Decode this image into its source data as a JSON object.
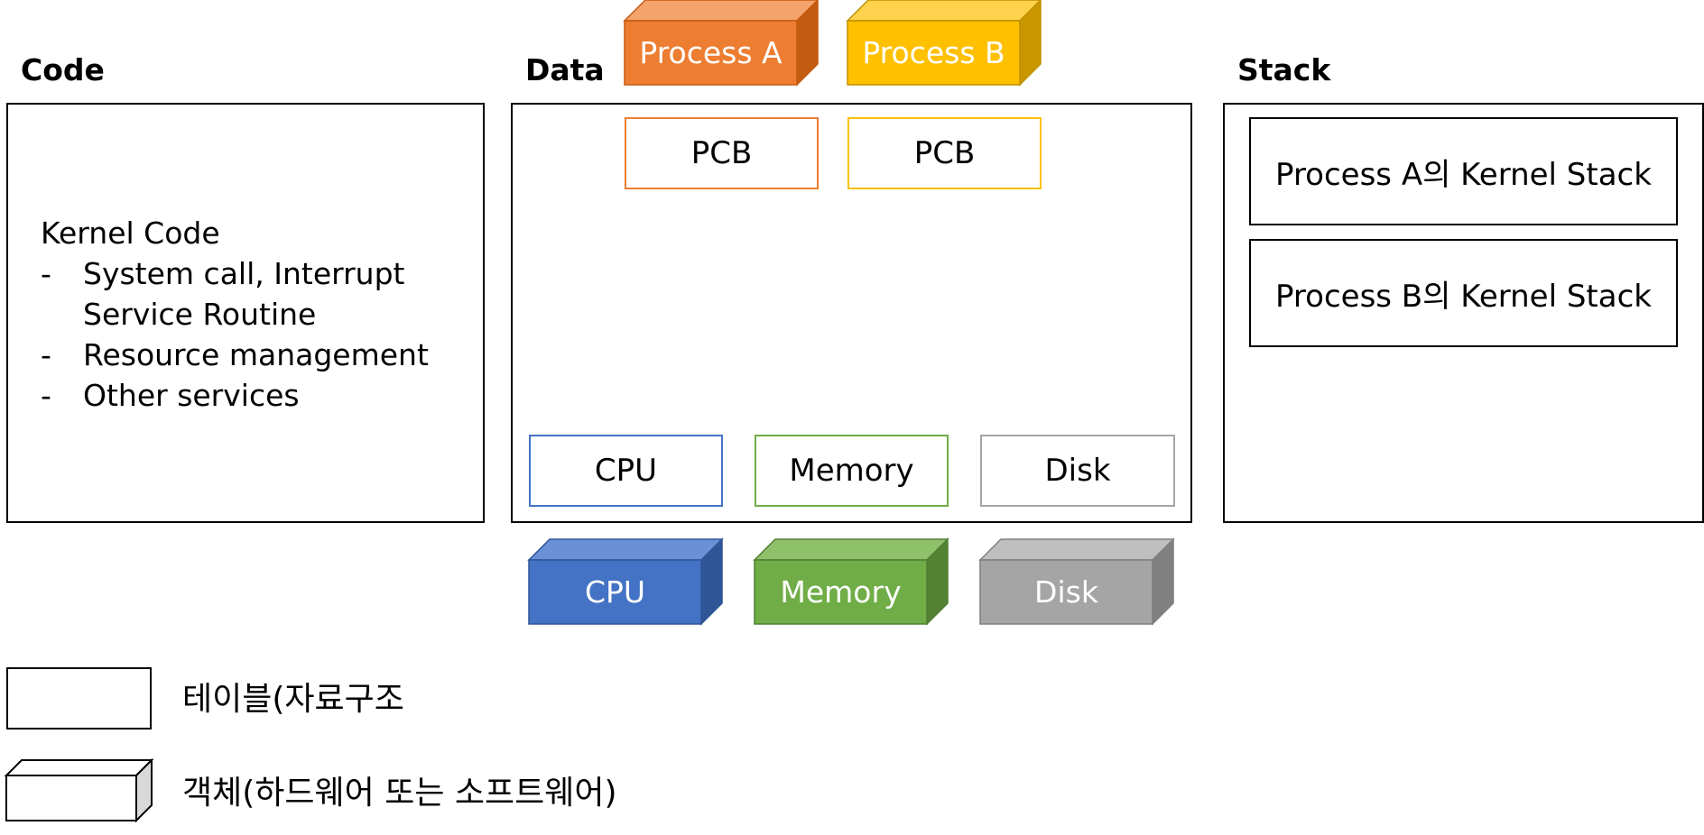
{
  "headings": {
    "code": "Code",
    "data": "Data",
    "stack": "Stack"
  },
  "code_panel": {
    "title": "Kernel Code",
    "items": [
      "System call, Interrupt Service Routine",
      "Resource management",
      "Other services"
    ],
    "bullet": "-"
  },
  "data_panel": {
    "process_objects": [
      {
        "label": "Process A",
        "color": "#ED7D31"
      },
      {
        "label": "Process B",
        "color": "#FFC000"
      }
    ],
    "pcb_tables": [
      {
        "label": "PCB",
        "border_color": "#ED7D31"
      },
      {
        "label": "PCB",
        "border_color": "#FFC000"
      }
    ],
    "resource_tables": [
      {
        "label": "CPU",
        "border_color": "#4472C4"
      },
      {
        "label": "Memory",
        "border_color": "#70AD47"
      },
      {
        "label": "Disk",
        "border_color": "#A5A5A5"
      }
    ],
    "hardware_objects": [
      {
        "label": "CPU",
        "color": "#4472C4"
      },
      {
        "label": "Memory",
        "color": "#70AD47"
      },
      {
        "label": "Disk",
        "color": "#A5A5A5"
      }
    ]
  },
  "stack_panel": {
    "stacks": [
      {
        "label": "Process A의 Kernel Stack"
      },
      {
        "label": "Process B의 Kernel Stack"
      }
    ]
  },
  "legend": {
    "table_label": "테이블(자료구조",
    "object_label": "객체(하드웨어 또는 소프트웨어)"
  }
}
